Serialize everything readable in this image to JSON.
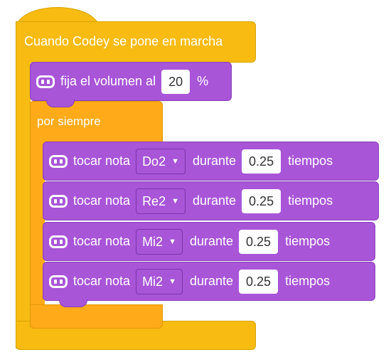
{
  "event_block": {
    "label": "Cuando Codey se pone en marcha"
  },
  "volume_block": {
    "label": "fija el volumen al",
    "value": "20",
    "unit": "%",
    "icon": "codey-robot-icon"
  },
  "forever_block": {
    "label": "por siempre"
  },
  "note_blocks": [
    {
      "label": "tocar nota",
      "note": "Do2",
      "during": "durante",
      "beats": "0.25",
      "beats_unit": "tiempos",
      "icon": "codey-robot-icon"
    },
    {
      "label": "tocar nota",
      "note": "Re2",
      "during": "durante",
      "beats": "0.25",
      "beats_unit": "tiempos",
      "icon": "codey-robot-icon"
    },
    {
      "label": "tocar nota",
      "note": "Mi2",
      "during": "durante",
      "beats": "0.25",
      "beats_unit": "tiempos",
      "icon": "codey-robot-icon"
    },
    {
      "label": "tocar nota",
      "note": "Mi2",
      "during": "durante",
      "beats": "0.25",
      "beats_unit": "tiempos",
      "icon": "codey-robot-icon"
    }
  ],
  "colors": {
    "event": "#F7BB12",
    "control": "#FFAB19",
    "codey": "#A855D8"
  }
}
